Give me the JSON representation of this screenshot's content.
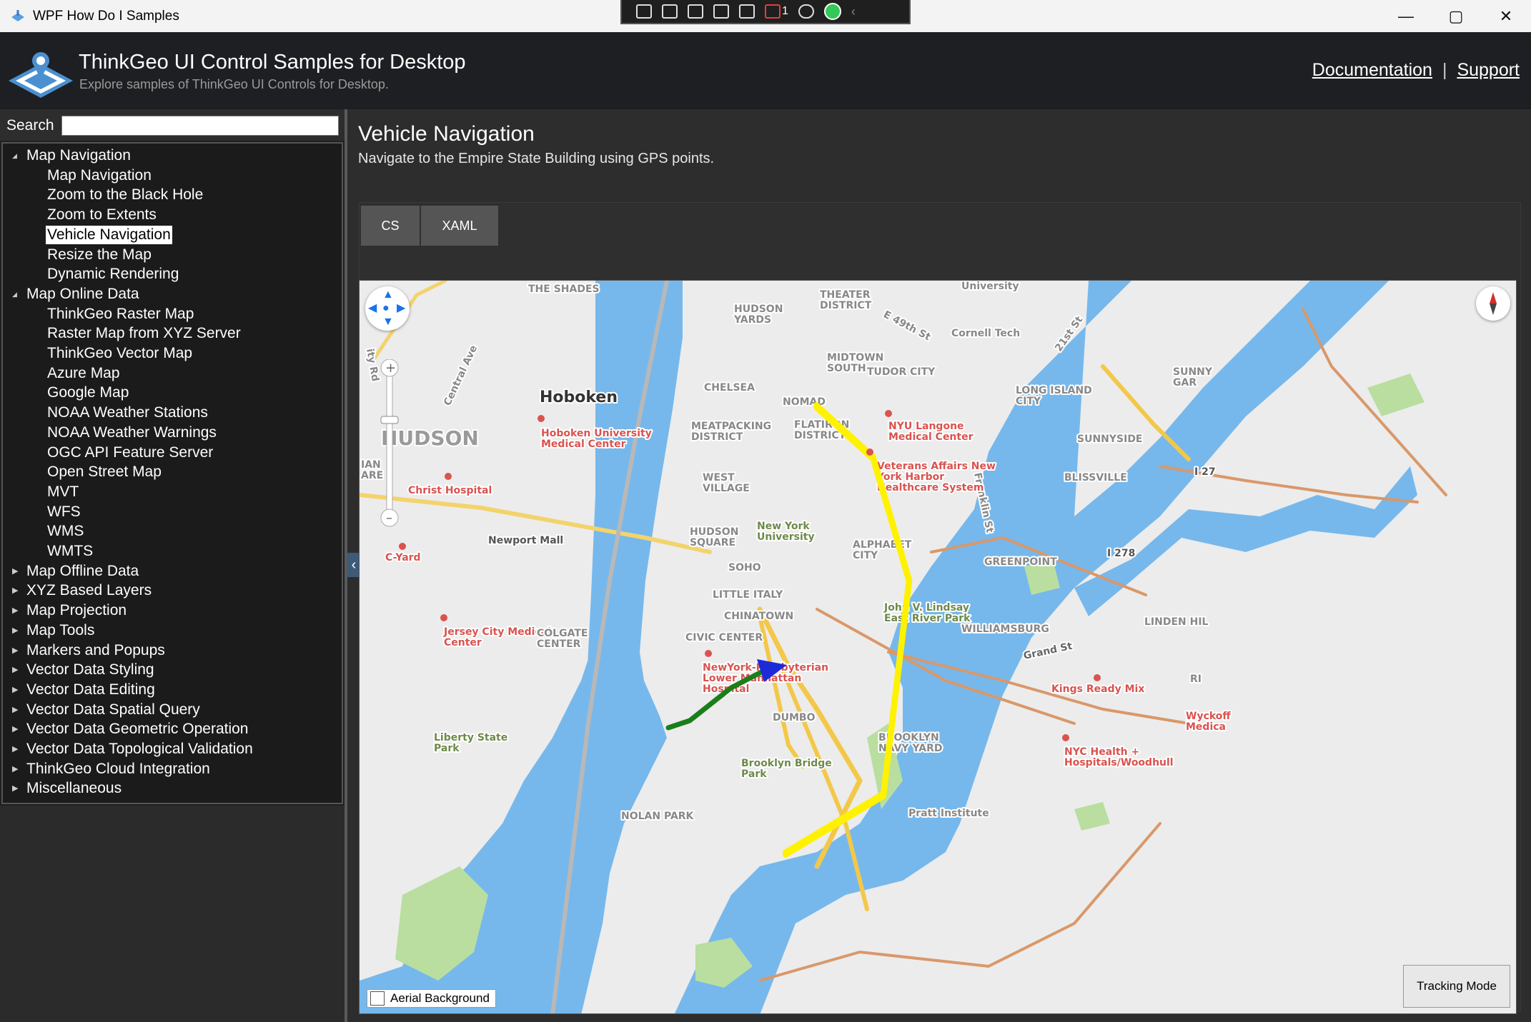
{
  "window": {
    "title": "WPF How Do I Samples",
    "minimize_glyph": "—",
    "maximize_glyph": "▢",
    "close_glyph": "✕"
  },
  "debug_toolbar": {
    "counter": "1"
  },
  "header": {
    "title": "ThinkGeo UI Control Samples for Desktop",
    "subtitle": "Explore samples of ThinkGeo UI Controls for Desktop.",
    "documentation_link": "Documentation",
    "separator": "|",
    "support_link": "Support"
  },
  "search": {
    "label": "Search",
    "value": ""
  },
  "tree": [
    {
      "label": "Map Navigation",
      "level": 0,
      "expanded": true
    },
    {
      "label": "Map Navigation",
      "level": 1
    },
    {
      "label": "Zoom to the Black Hole",
      "level": 1
    },
    {
      "label": "Zoom to Extents",
      "level": 1
    },
    {
      "label": "Vehicle Navigation",
      "level": 1,
      "selected": true
    },
    {
      "label": "Resize the Map",
      "level": 1
    },
    {
      "label": "Dynamic Rendering",
      "level": 1
    },
    {
      "label": "Map Online Data",
      "level": 0,
      "expanded": true
    },
    {
      "label": "ThinkGeo Raster Map",
      "level": 1
    },
    {
      "label": "Raster Map from XYZ Server",
      "level": 1
    },
    {
      "label": "ThinkGeo Vector Map",
      "level": 1
    },
    {
      "label": "Azure Map",
      "level": 1
    },
    {
      "label": "Google Map",
      "level": 1
    },
    {
      "label": "NOAA Weather Stations",
      "level": 1
    },
    {
      "label": "NOAA Weather Warnings",
      "level": 1
    },
    {
      "label": "OGC API Feature Server",
      "level": 1
    },
    {
      "label": "Open Street Map",
      "level": 1
    },
    {
      "label": "MVT",
      "level": 1
    },
    {
      "label": "WFS",
      "level": 1
    },
    {
      "label": "WMS",
      "level": 1
    },
    {
      "label": "WMTS",
      "level": 1
    },
    {
      "label": "Map Offline Data",
      "level": 0,
      "expanded": false
    },
    {
      "label": "XYZ Based Layers",
      "level": 0,
      "expanded": false
    },
    {
      "label": "Map Projection",
      "level": 0,
      "expanded": false
    },
    {
      "label": "Map Tools",
      "level": 0,
      "expanded": false
    },
    {
      "label": "Markers and Popups",
      "level": 0,
      "expanded": false
    },
    {
      "label": "Vector Data Styling",
      "level": 0,
      "expanded": false
    },
    {
      "label": "Vector Data Editing",
      "level": 0,
      "expanded": false
    },
    {
      "label": "Vector Data Spatial Query",
      "level": 0,
      "expanded": false
    },
    {
      "label": "Vector Data Geometric Operation",
      "level": 0,
      "expanded": false
    },
    {
      "label": "Vector Data Topological Validation",
      "level": 0,
      "expanded": false
    },
    {
      "label": "ThinkGeo Cloud Integration",
      "level": 0,
      "expanded": false
    },
    {
      "label": "Miscellaneous",
      "level": 0,
      "expanded": false
    }
  ],
  "content": {
    "title": "Vehicle Navigation",
    "description": "Navigate to the Empire State Building using GPS points.",
    "tabs": [
      "CS",
      "XAML"
    ]
  },
  "map": {
    "aerial_label": "Aerial Background",
    "aerial_checked": false,
    "tracking_button": "Tracking Mode",
    "colors": {
      "water": "#76b8ec",
      "land": "#ececec",
      "park": "#b9dea0",
      "route_future": "#fff200",
      "route_traveled": "#1a7f1a",
      "vehicle": "#1c2bd8"
    },
    "labels": {
      "hoboken": "Hoboken",
      "hudson": "HUDSON",
      "the_shades": "THE SHADES",
      "hudson_yards": "HUDSON\nYARDS",
      "theater_district": "THEATER\nDISTRICT",
      "university": "University",
      "e49": "E 49th St",
      "cornell": "Cornell Tech",
      "st21": "21st St",
      "sunnygar": "SUNNY\nGAR",
      "midtown_south": "MIDTOWN\nSOUTH",
      "tudor_city": "TUDOR CITY",
      "long_island_city": "LONG ISLAND\nCITY",
      "chelsea": "CHELSEA",
      "nomad": "NOMAD",
      "central_ave": "Central Ave",
      "hoboken_umc": "Hoboken University\nMedical Center",
      "meatpacking": "MEATPACKING\nDISTRICT",
      "flatiron": "FLATIRON\nDISTRICT",
      "nyu_langone": "NYU Langone\nMedical Center",
      "sunnyside": "SUNNYSIDE",
      "veterans": "Veterans Affairs New\nYork Harbor\nHealthcare System",
      "west_village": "WEST\nVILLAGE",
      "blissville": "BLISSVILLE",
      "i27": "I 27",
      "christ_hospital": "Christ Hospital",
      "franklin_st": "Franklin St",
      "newport_mall": "Newport Mall",
      "hudson_square": "HUDSON\nSQUARE",
      "nyu": "New York\nUniversity",
      "alphabet_city": "ALPHABET\nCITY",
      "i278": "I 278",
      "c_yard": "C-Yard",
      "soho": "SOHO",
      "greenpoint": "GREENPOINT",
      "little_italy": "LITTLE ITALY",
      "chinatown": "CHINATOWN",
      "jvl_park": "John V. Lindsay\nEast River Park",
      "williamsburg": "WILLIAMSBURG",
      "linden_hill": "LINDEN HIL",
      "jersey_city_mc": "Jersey City Medical\nCenter",
      "colgate_center": "COLGATE\nCENTER",
      "civic_center": "CIVIC CENTER",
      "grand_st": "Grand St",
      "nyp_lower": "NewYork-Presbyterian\nLower Manhattan\nHospital",
      "kings_ready_mix": "Kings Ready Mix",
      "ri": "RI",
      "wyckoff": "Wyckoff\nMedica",
      "dumbo": "DUMBO",
      "liberty_park": "Liberty State\nPark",
      "brooklyn_navy_yard": "BROOKLYN\nNAVY YARD",
      "nyc_health": "NYC Health +\nHospitals/Woodhull",
      "brooklyn_bridge_park": "Brooklyn Bridge\nPark",
      "pratt": "Pratt Institute",
      "nolan_park": "NOLAN PARK",
      "ian": "IAN\nARE",
      "ity_rd": "ity Rd"
    }
  }
}
